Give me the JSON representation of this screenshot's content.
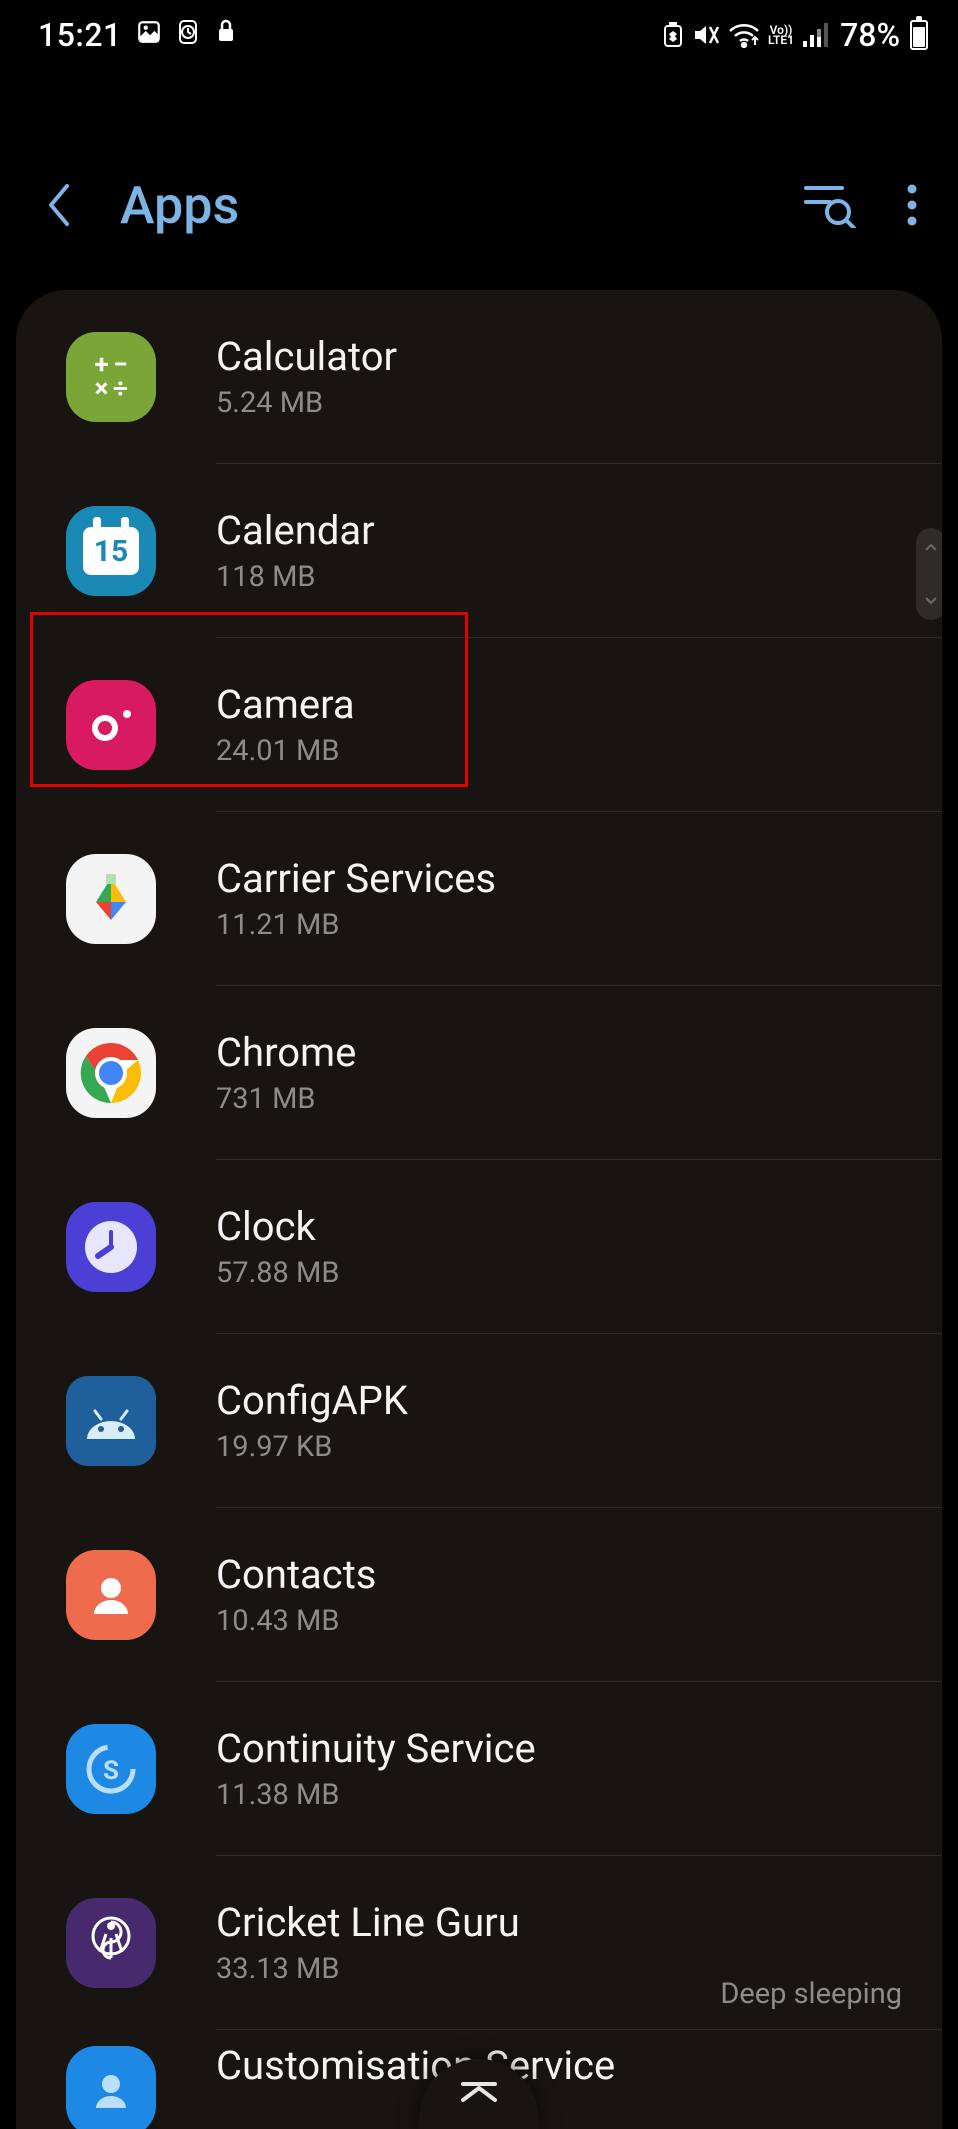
{
  "status_bar": {
    "time": "15:21",
    "network_label": "LTE1",
    "vo_label": "Vo))",
    "battery_percent": "78%"
  },
  "header": {
    "title": "Apps"
  },
  "apps": [
    {
      "name": "Calculator",
      "size": "5.24 MB",
      "icon": "calculator",
      "status": ""
    },
    {
      "name": "Calendar",
      "size": "118 MB",
      "icon": "calendar",
      "status": ""
    },
    {
      "name": "Camera",
      "size": "24.01 MB",
      "icon": "camera",
      "status": ""
    },
    {
      "name": "Carrier Services",
      "size": "11.21 MB",
      "icon": "carrier",
      "status": ""
    },
    {
      "name": "Chrome",
      "size": "731 MB",
      "icon": "chrome",
      "status": ""
    },
    {
      "name": "Clock",
      "size": "57.88 MB",
      "icon": "clock",
      "status": ""
    },
    {
      "name": "ConfigAPK",
      "size": "19.97 KB",
      "icon": "configapk",
      "status": ""
    },
    {
      "name": "Contacts",
      "size": "10.43 MB",
      "icon": "contacts",
      "status": ""
    },
    {
      "name": "Continuity Service",
      "size": "11.38 MB",
      "icon": "continuity",
      "status": ""
    },
    {
      "name": "Cricket Line Guru",
      "size": "33.13 MB",
      "icon": "cricket",
      "status": "Deep sleeping"
    },
    {
      "name": "Customisation Service",
      "size": "",
      "icon": "custom",
      "status": ""
    }
  ],
  "calendar_day": "15",
  "highlighted_index": 2
}
